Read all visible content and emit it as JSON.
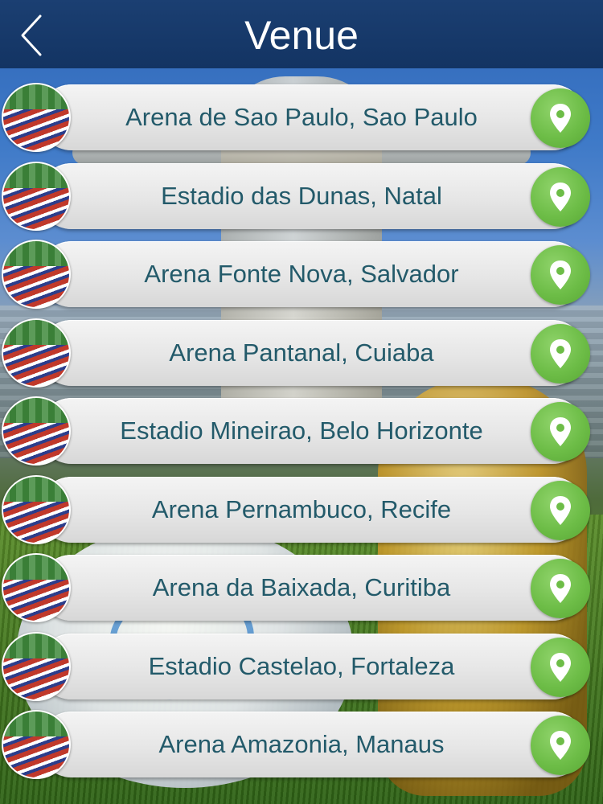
{
  "header": {
    "title": "Venue",
    "back_icon": "chevron-left-icon",
    "color": "#1b3f72"
  },
  "venues": [
    {
      "label": "Arena de Sao Paulo, Sao Paulo"
    },
    {
      "label": "Estadio das Dunas, Natal"
    },
    {
      "label": "Arena Fonte Nova, Salvador"
    },
    {
      "label": "Arena Pantanal, Cuiaba"
    },
    {
      "label": "Estadio Mineirao, Belo Horizonte"
    },
    {
      "label": "Arena Pernambuco, Recife"
    },
    {
      "label": "Arena da Baixada, Curitiba"
    },
    {
      "label": "Estadio Castelao, Fortaleza"
    },
    {
      "label": "Arena Amazonia, Manaus"
    }
  ],
  "row_icons": {
    "thumbnail": "stadium-photo",
    "action": "map-pin-icon"
  },
  "colors": {
    "label_text": "#235a6a",
    "pin_green": "#6dbd47",
    "pill": "#e6e6e6"
  }
}
